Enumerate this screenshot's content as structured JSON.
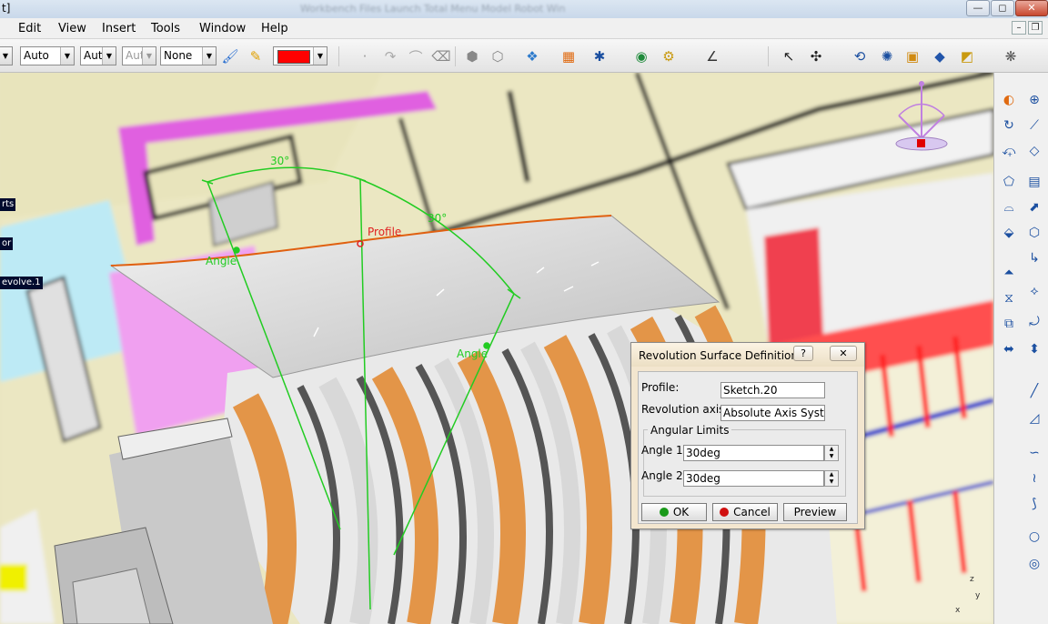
{
  "window": {
    "title": "Workbench Files Launch Total Menu Model Robot Win",
    "min_glyph": "—",
    "max_glyph": "◻",
    "close_glyph": "✕",
    "corner_label": "t]"
  },
  "menu": {
    "items": [
      "Edit",
      "View",
      "Insert",
      "Tools",
      "Window",
      "Help"
    ],
    "mdi_min": "–",
    "mdi_restore": "❐",
    "mdi_close": "✕"
  },
  "toolbar": {
    "line_type": "Auto",
    "line_thickness": "Aut",
    "point_type": "Aut",
    "layer": "None",
    "color": "#ff0000"
  },
  "tree": {
    "items": [
      "rts",
      "or",
      "evolve.1"
    ]
  },
  "viewport": {
    "annotations": {
      "angle_value_1": "30°",
      "angle_value_2": "30°",
      "profile_label": "Profile",
      "angle_label_1": "Angle",
      "angle_label_2": "Angle"
    },
    "compass_axis_x": "x",
    "compass_axis_y": "y",
    "compass_axis_z": "z"
  },
  "dialog": {
    "title": "Revolution Surface Definition",
    "help_glyph": "?",
    "close_glyph": "✕",
    "profile_label": "Profile:",
    "profile_value": "Sketch.20",
    "axis_label": "Revolution axis:",
    "axis_value": "Absolute Axis System",
    "group_title": "Angular Limits",
    "angle1_label": "Angle 1:",
    "angle1_value": "30deg",
    "angle2_label": "Angle 2:",
    "angle2_value": "30deg",
    "ok_label": "OK",
    "cancel_label": "Cancel",
    "preview_label": "Preview"
  },
  "colors": {
    "ok_dot": "#1a9a1a",
    "cancel_dot": "#d01010",
    "construction_lines": "#22cc22",
    "profile_curve": "#e06010"
  }
}
